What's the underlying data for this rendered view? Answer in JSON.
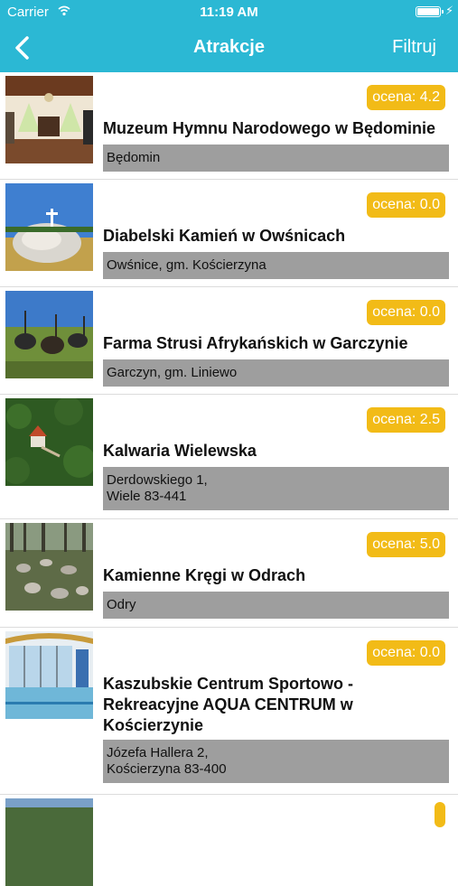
{
  "status_bar": {
    "carrier": "Carrier",
    "time": "11:19 AM"
  },
  "nav": {
    "title": "Atrakcje",
    "filter_label": "Filtruj",
    "back_icon": "chevron-left-icon"
  },
  "colors": {
    "accent": "#2bb8d4",
    "badge": "#f2bb17",
    "address_bg": "#9e9e9e"
  },
  "attractions": [
    {
      "rating": "ocena: 4.2",
      "title": "Muzeum Hymnu Narodowego w Będominie",
      "address": "Będomin"
    },
    {
      "rating": "ocena: 0.0",
      "title": "Diabelski Kamień w Owśnicach",
      "address": "Owśnice, gm. Kościerzyna"
    },
    {
      "rating": "ocena: 0.0",
      "title": "Farma Strusi Afrykańskich w Garczynie",
      "address": "Garczyn, gm. Liniewo"
    },
    {
      "rating": "ocena: 2.5",
      "title": "Kalwaria Wielewska",
      "address_line1": "Derdowskiego 1,",
      "address_line2": "Wiele 83-441"
    },
    {
      "rating": "ocena: 5.0",
      "title": "Kamienne Kręgi w Odrach",
      "address": "Odry"
    },
    {
      "rating": "ocena: 0.0",
      "title_line1": "Kaszubskie Centrum Sportowo -",
      "title_line2": "Rekreacyjne AQUA CENTRUM w",
      "title_line3": "Kościerzynie",
      "address_line1": "Józefa Hallera 2,",
      "address_line2": "Kościerzyna 83-400"
    }
  ]
}
